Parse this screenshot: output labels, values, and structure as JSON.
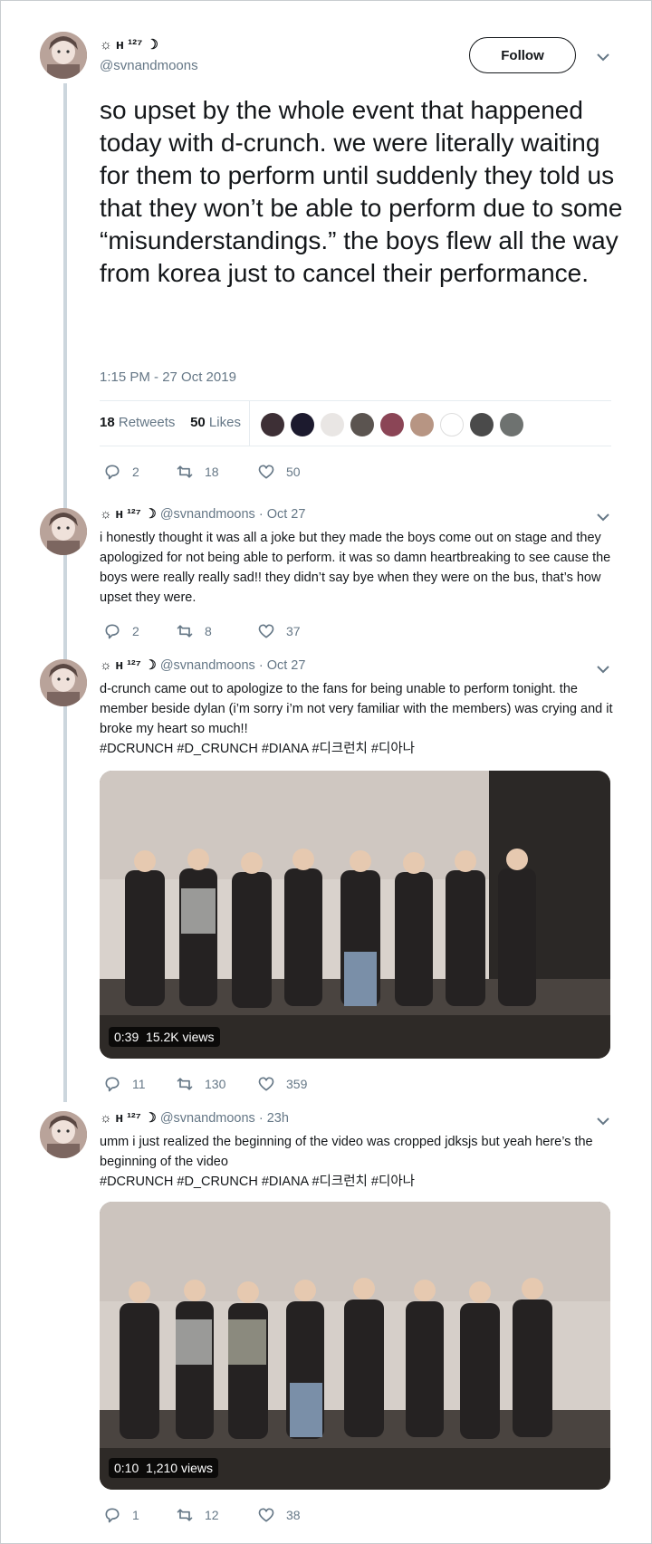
{
  "main_tweet": {
    "display_name": "☼ ʜ ¹²⁷ ☽",
    "handle": "@svnandmoons",
    "follow_label": "Follow",
    "text": "so upset by the whole event that happened today with d-crunch. we were literally waiting for them to perform until suddenly they told us that they won’t be able to perform due to some “misunderstandings.” the boys flew all the way from korea just to cancel their performance.",
    "timestamp": "1:15 PM - 27 Oct 2019",
    "retweets_count": "18",
    "retweets_label": "Retweets",
    "likes_count": "50",
    "likes_label": "Likes",
    "actions": {
      "replies": "2",
      "retweets": "18",
      "likes": "50"
    }
  },
  "replies": [
    {
      "display_name": "☼ ʜ ¹²⁷ ☽",
      "meta": "@svnandmoons · Oct 27",
      "text": "i honestly thought it was all a joke but they made the boys come out on stage and they apologized for not being able to perform. it was so damn heartbreaking to see cause the boys were really really sad!! they didn’t say bye when they were on the bus, that’s how upset they were.",
      "actions": {
        "replies": "2",
        "retweets": "8",
        "likes": "37"
      }
    },
    {
      "display_name": "☼ ʜ ¹²⁷ ☽",
      "meta": "@svnandmoons · Oct 27",
      "text": "d-crunch came out to apologize to the fans for being unable to perform tonight. the member beside dylan (i’m sorry i’m not very familiar with the members) was crying and it broke my heart so much!!",
      "hashtags": "#DCRUNCH #D_CRUNCH #DIANA #디크런치 #디아나",
      "video_duration": "0:39",
      "video_views": "15.2K views",
      "actions": {
        "replies": "11",
        "retweets": "130",
        "likes": "359"
      }
    },
    {
      "display_name": "☼ ʜ ¹²⁷ ☽",
      "meta": "@svnandmoons · 23h",
      "text": "umm i just realized the beginning of the video was cropped jdksjs but yeah here’s the beginning of the video",
      "hashtags": "#DCRUNCH #D_CRUNCH #DIANA #디크런치 #디아나",
      "video_duration": "0:10",
      "video_views": "1,210 views",
      "actions": {
        "replies": "1",
        "retweets": "12",
        "likes": "38"
      }
    }
  ],
  "icons": [
    "reply-icon",
    "retweet-icon",
    "like-icon",
    "chevron-down-icon"
  ],
  "colors": {
    "text": "#14171a",
    "muted": "#657786",
    "divider": "#e6ecf0"
  }
}
